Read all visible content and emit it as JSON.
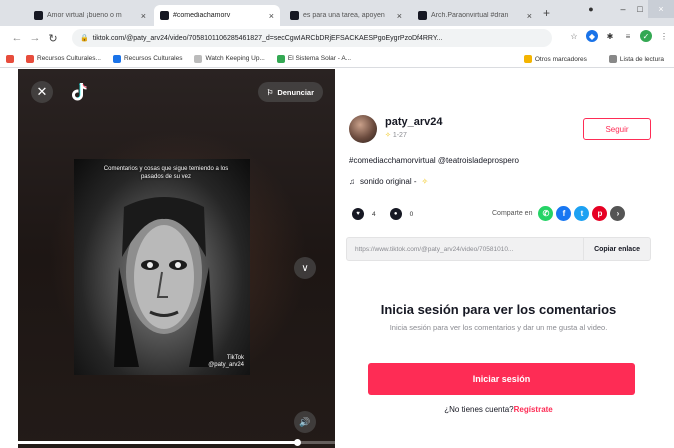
{
  "browser": {
    "tabs": [
      {
        "title": "Amor virtual ¡bueno o m",
        "active": false
      },
      {
        "title": "#comediachamorv",
        "active": true
      },
      {
        "title": "es para una tarea, apoyen",
        "active": false
      },
      {
        "title": "Arch.Paraonvirtual #dran",
        "active": false
      }
    ],
    "url": "tiktok.com/@paty_arv24/video/7058101106285461827_d=secCgwIARCbDRjEFSACKAESPgoEygrPzoDf4RRY...",
    "bookmarks": [
      {
        "label": "Recursos Culturales...",
        "color": "#e74c3c"
      },
      {
        "label": "Recursos Culturales",
        "color": "#1a73e8"
      },
      {
        "label": "Watch Keeping Up...",
        "color": "#bbbbbb"
      },
      {
        "label": "El Sistema Solar - A...",
        "color": "#34a853"
      }
    ],
    "bookmarks_right": [
      "Otros marcadores",
      "Lista de lectura"
    ],
    "accent_colors": {
      "tiktok_red": "#fe2c55",
      "whatsapp": "#25d366",
      "facebook": "#1877f2",
      "twitter": "#1da1f2",
      "pinterest": "#e60023"
    }
  },
  "video": {
    "report_label": "Denunciar",
    "caption_text": "Comentarios y cosas que sigue temiendo a los pasados de su vez",
    "watermark_brand": "TikTok",
    "watermark_handle": "@paty_arv24",
    "progress_fraction": 0.88
  },
  "post": {
    "username": "paty_arv24",
    "date": "1-27",
    "follow_label": "Seguir",
    "description": "#comediacchamorvirtual @teatroisladeprospero",
    "sound": "sonido original -",
    "likes": "4",
    "comments": "0",
    "share_label": "Comparte en",
    "share_icons": [
      "whatsapp-icon",
      "facebook-icon",
      "twitter-icon",
      "pinterest-icon",
      "more-share-icon"
    ],
    "link": "https://www.tiktok.com/@paty_arv24/video/70581010...",
    "copy_label": "Copiar enlace"
  },
  "comments_login": {
    "title": "Inicia sesión para ver los comentarios",
    "subtitle": "Inicia sesión para ver los comentarios y dar un me gusta al video.",
    "button_label": "Iniciar sesión",
    "signup_prompt": "¿No tienes cuenta?",
    "signup_link": "Regístrate"
  }
}
